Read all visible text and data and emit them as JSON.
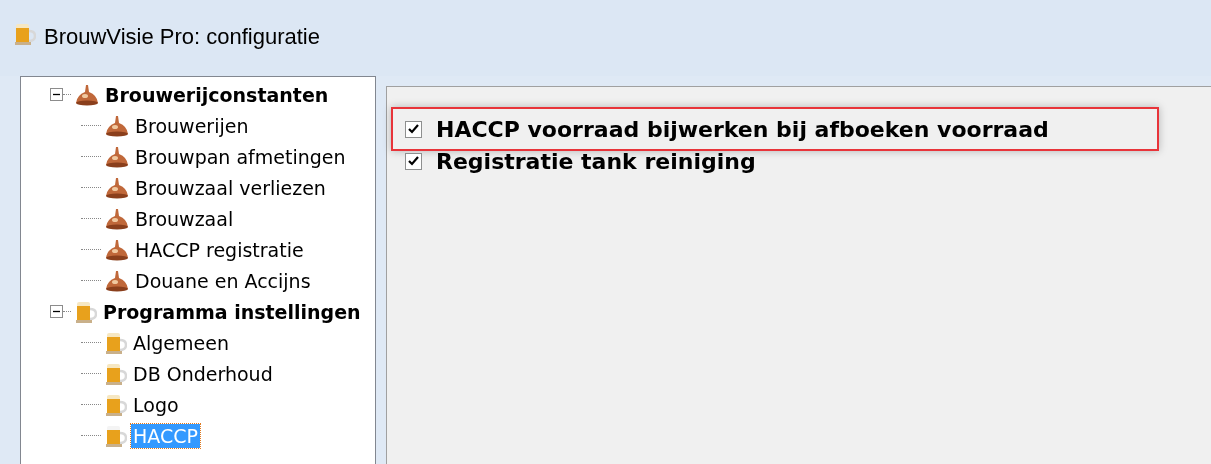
{
  "window": {
    "title": "BrouwVisie Pro: configuratie"
  },
  "tree": [
    {
      "label": "Brouwerijconstanten",
      "kind": "kettle",
      "expanded": true,
      "selected": false,
      "children": [
        {
          "label": "Brouwerijen",
          "kind": "kettle",
          "selected": false
        },
        {
          "label": "Brouwpan afmetingen",
          "kind": "kettle",
          "selected": false
        },
        {
          "label": "Brouwzaal verliezen",
          "kind": "kettle",
          "selected": false
        },
        {
          "label": "Brouwzaal",
          "kind": "kettle",
          "selected": false
        },
        {
          "label": "HACCP registratie",
          "kind": "kettle",
          "selected": false
        },
        {
          "label": "Douane en Accijns",
          "kind": "kettle",
          "selected": false
        }
      ]
    },
    {
      "label": "Programma instellingen",
      "kind": "mug",
      "expanded": true,
      "selected": false,
      "children": [
        {
          "label": "Algemeen",
          "kind": "mug",
          "selected": false
        },
        {
          "label": "DB Onderhoud",
          "kind": "mug",
          "selected": false
        },
        {
          "label": "Logo",
          "kind": "mug",
          "selected": false
        },
        {
          "label": "HACCP",
          "kind": "mug",
          "selected": true
        }
      ]
    }
  ],
  "options": [
    {
      "label": "HACCP voorraad bijwerken bij afboeken voorraad",
      "checked": true,
      "highlighted": true
    },
    {
      "label": "Registratie tank reiniging",
      "checked": true,
      "highlighted": false
    }
  ]
}
